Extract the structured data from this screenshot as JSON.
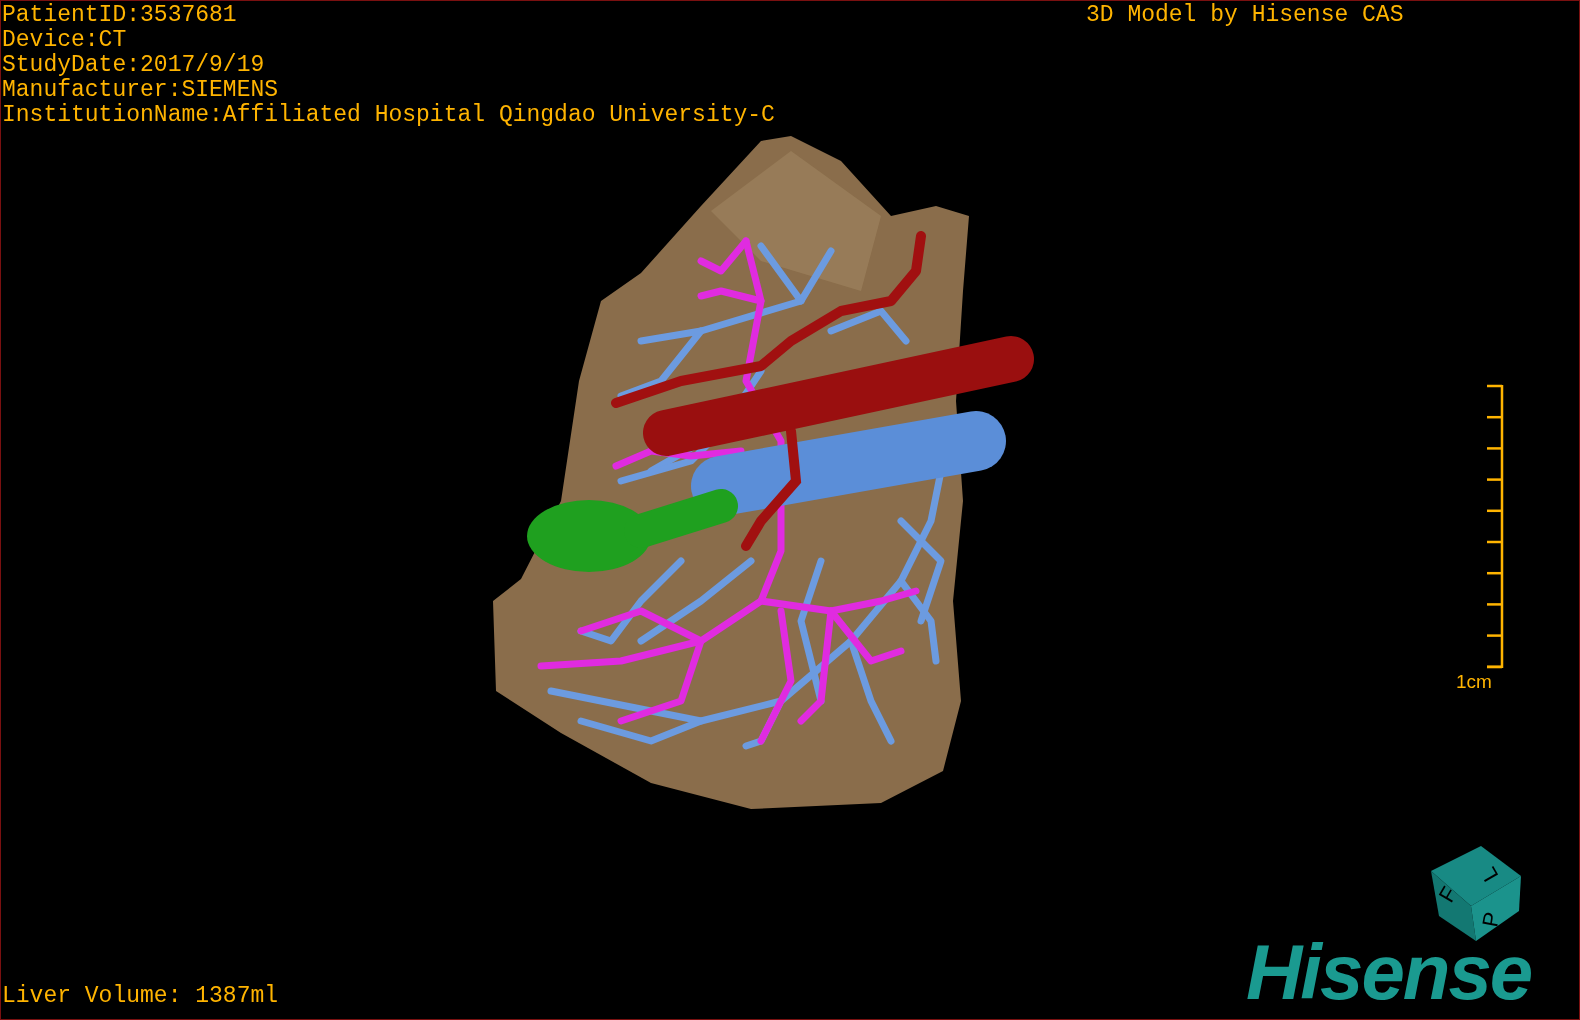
{
  "overlay": {
    "patient_info": [
      "PatientID:3537681",
      "Device:CT",
      "StudyDate:2017/9/19",
      "Manufacturer:SIEMENS",
      "InstitutionName:Affiliated Hospital Qingdao University-C"
    ],
    "credit": "3D Model by Hisense CAS",
    "liver_volume": "Liver Volume: 1387ml"
  },
  "scale_bar": {
    "label": "1cm"
  },
  "orientation_cube": {
    "faces": [
      "F",
      "L",
      "P"
    ]
  },
  "logo": {
    "text": "Hisense"
  }
}
